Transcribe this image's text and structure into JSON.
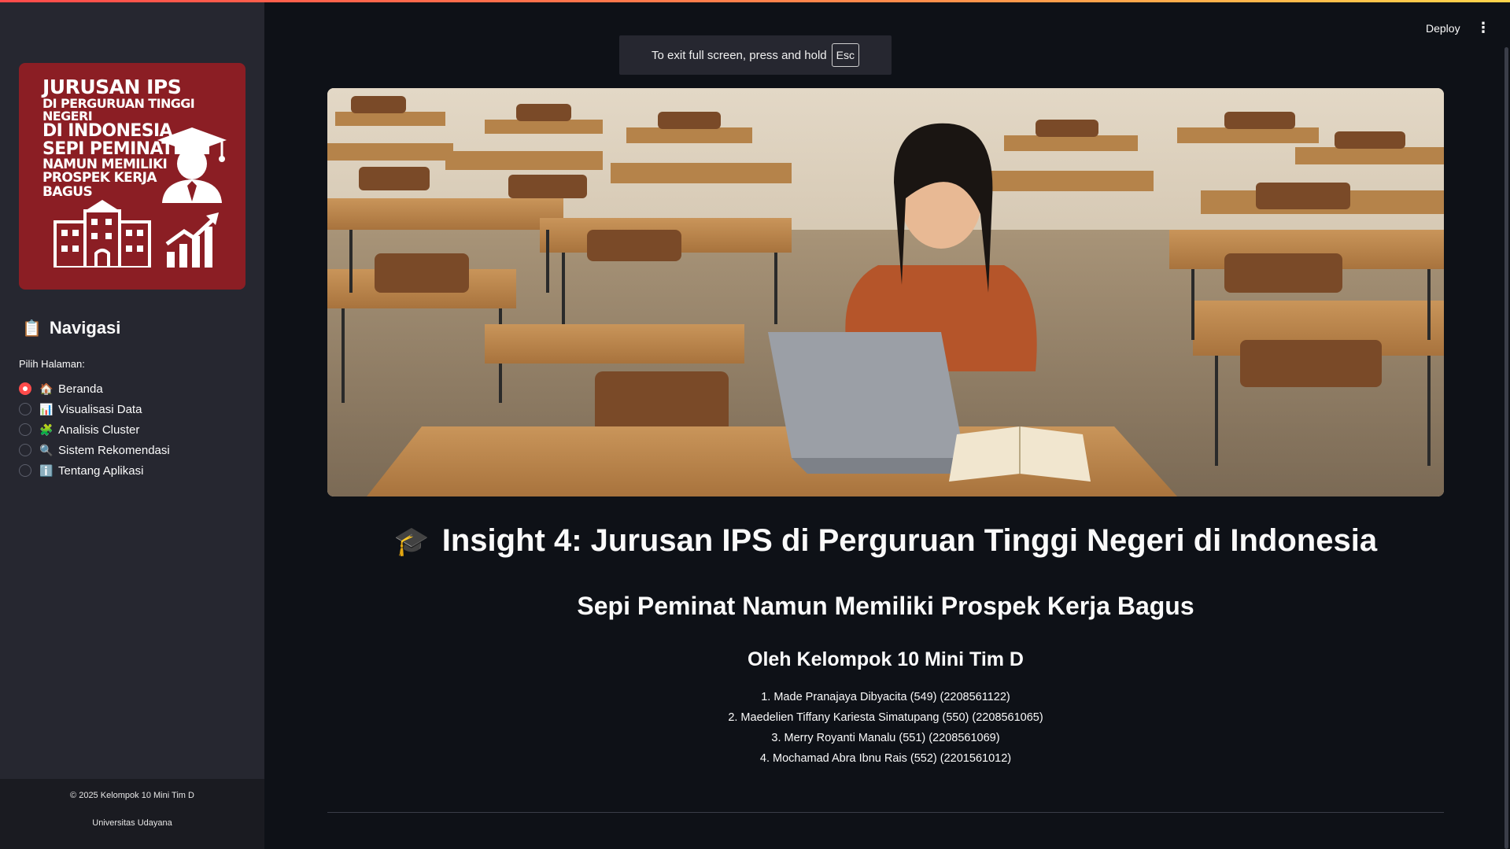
{
  "header": {
    "deploy_label": "Deploy",
    "menu_icon": "kebab-menu-icon"
  },
  "fullscreen_notice": {
    "text": "To exit full screen, press and hold",
    "key": "Esc"
  },
  "sidebar": {
    "banner": {
      "line1": "JURUSAN IPS",
      "line2": "DI PERGURUAN TINGGI NEGERI",
      "line3": "DI INDONESIA",
      "line4": "SEPI PEMINAT",
      "line5": "NAMUN MEMILIKI",
      "line6": "PROSPEK KERJA",
      "line7": "BAGUS",
      "bg_color": "#8b1e24"
    },
    "nav_heading": "Navigasi",
    "nav_heading_icon": "clipboard-icon",
    "nav_label": "Pilih Halaman:",
    "items": [
      {
        "label": "Beranda",
        "icon": "house-icon",
        "glyph": "🏠",
        "selected": true
      },
      {
        "label": "Visualisasi Data",
        "icon": "bar-chart-icon",
        "glyph": "📊",
        "selected": false
      },
      {
        "label": "Analisis Cluster",
        "icon": "puzzle-icon",
        "glyph": "🧩",
        "selected": false
      },
      {
        "label": "Sistem Rekomendasi",
        "icon": "magnifier-icon",
        "glyph": "🔍",
        "selected": false
      },
      {
        "label": "Tentang Aplikasi",
        "icon": "info-icon",
        "glyph": "ℹ️",
        "selected": false
      }
    ],
    "footer": {
      "copyright": "© 2025 Kelompok 10 Mini Tim D",
      "university": "Universitas Udayana"
    }
  },
  "main": {
    "title": "Insight 4: Jurusan IPS di Perguruan Tinggi Negeri di Indonesia",
    "title_icon": "graduation-cap-icon",
    "subtitle": "Sepi Peminat Namun Memiliki Prospek Kerja Bagus",
    "byline": "Oleh Kelompok 10 Mini Tim D",
    "members": [
      "1. Made Pranajaya Dibyacita (549) (2208561122)",
      "2. Maedelien Tiffany Kariesta Simatupang (550) (2208561065)",
      "3. Merry Royanti Manalu (551) (2208561069)",
      "4. Mochamad Abra Ibnu Rais (552) (2201561012)"
    ]
  },
  "colors": {
    "accent": "#ff4b4b",
    "background": "#0e1117",
    "sidebar": "#262730"
  }
}
